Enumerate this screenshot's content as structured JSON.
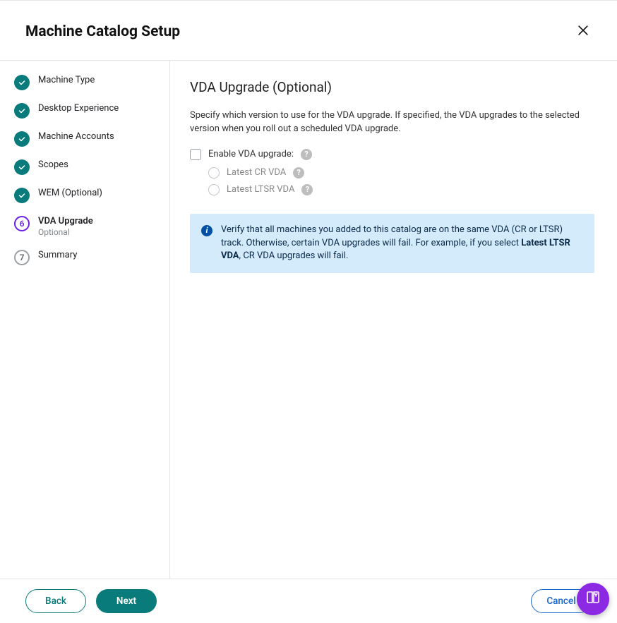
{
  "header": {
    "title": "Machine Catalog Setup"
  },
  "sidebar": {
    "steps": [
      {
        "label": "Machine Type",
        "state": "done"
      },
      {
        "label": "Desktop Experience",
        "state": "done"
      },
      {
        "label": "Machine Accounts",
        "state": "done"
      },
      {
        "label": "Scopes",
        "state": "done"
      },
      {
        "label": "WEM (Optional)",
        "state": "done"
      },
      {
        "label": "VDA Upgrade",
        "sub": "Optional",
        "state": "current",
        "number": "6"
      },
      {
        "label": "Summary",
        "state": "future",
        "number": "7"
      }
    ]
  },
  "content": {
    "title": "VDA Upgrade (Optional)",
    "description": "Specify which version to use for the VDA upgrade. If specified, the VDA upgrades to the selected version when you roll out a scheduled VDA upgrade.",
    "checkbox_label": "Enable VDA upgrade:",
    "radios": [
      {
        "label": "Latest CR VDA"
      },
      {
        "label": "Latest LTSR VDA"
      }
    ],
    "info_pre": "Verify that all machines you added to this catalog are on the same VDA (CR or LTSR) track. Otherwise, certain VDA upgrades will fail. For example, if you select ",
    "info_bold": "Latest LTSR VDA",
    "info_post": ", CR VDA upgrades will fail."
  },
  "footer": {
    "back": "Back",
    "next": "Next",
    "cancel": "Cancel"
  },
  "icons": {
    "help": "?",
    "info": "i"
  }
}
